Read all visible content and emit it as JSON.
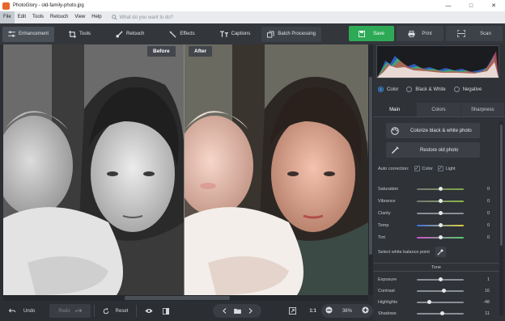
{
  "window": {
    "title": "PhotoGlory - old-family-photo.jpg"
  },
  "menu": {
    "items": [
      "File",
      "Edit",
      "Tools",
      "Retouch",
      "View",
      "Help"
    ],
    "search_placeholder": "What do you want to do?"
  },
  "toolbar": {
    "enhancement": "Enhancement",
    "tools": "Tools",
    "retouch": "Retouch",
    "effects": "Effects",
    "captions": "Captions",
    "batch": "Batch Processing",
    "save": "Save",
    "print": "Print",
    "scan": "Scan"
  },
  "canvas": {
    "before_label": "Before",
    "after_label": "After"
  },
  "bottom": {
    "undo": "Undo",
    "redo": "Redo",
    "reset": "Reset",
    "ratio": "1:1",
    "zoom": "38%"
  },
  "panel": {
    "modes": [
      {
        "label": "Color",
        "selected": true
      },
      {
        "label": "Black & White",
        "selected": false
      },
      {
        "label": "Negative",
        "selected": false
      }
    ],
    "tabs": [
      "Main",
      "Colors",
      "Sharpness"
    ],
    "colorize_btn": "Colorize black & white photo",
    "restore_btn": "Restore old photo",
    "auto_correction": {
      "label": "Auto correction:",
      "color": "Color",
      "light": "Light",
      "color_checked": true,
      "light_checked": true
    },
    "sliders": [
      {
        "label": "Saturation",
        "value": "0",
        "level": 0.5
      },
      {
        "label": "Vibrance",
        "value": "0",
        "level": 0.5
      },
      {
        "label": "Clarity",
        "value": "0",
        "level": 0.5
      },
      {
        "label": "Temp",
        "value": "0",
        "level": 0.5
      },
      {
        "label": "Tint",
        "value": "0",
        "level": 0.5
      }
    ],
    "white_balance": "Select white balance point",
    "tone_header": "Tone",
    "tone_sliders": [
      {
        "label": "Exposure",
        "value": "1",
        "level": 0.51
      },
      {
        "label": "Contrast",
        "value": "16",
        "level": 0.58
      },
      {
        "label": "Highlights",
        "value": "-48",
        "level": 0.26
      },
      {
        "label": "Shadows",
        "value": "11",
        "level": 0.55
      }
    ]
  },
  "colors": {
    "accent": "#2eaa57",
    "selected_blue": "#3b8de0",
    "background": "#2b2e33"
  }
}
